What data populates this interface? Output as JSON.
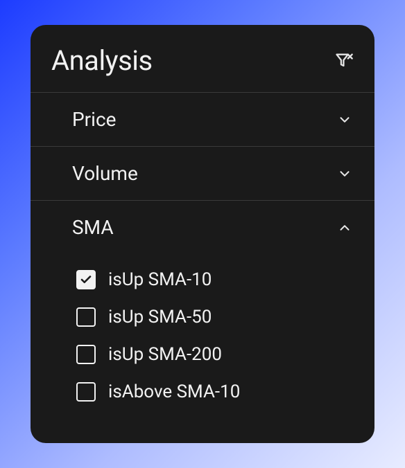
{
  "panel": {
    "title": "Analysis"
  },
  "sections": {
    "price": {
      "title": "Price",
      "expanded": false
    },
    "volume": {
      "title": "Volume",
      "expanded": false
    },
    "sma": {
      "title": "SMA",
      "expanded": true,
      "items": [
        {
          "label": "isUp SMA-10",
          "checked": true
        },
        {
          "label": "isUp SMA-50",
          "checked": false
        },
        {
          "label": "isUp SMA-200",
          "checked": false
        },
        {
          "label": "isAbove SMA-10",
          "checked": false
        }
      ]
    }
  }
}
